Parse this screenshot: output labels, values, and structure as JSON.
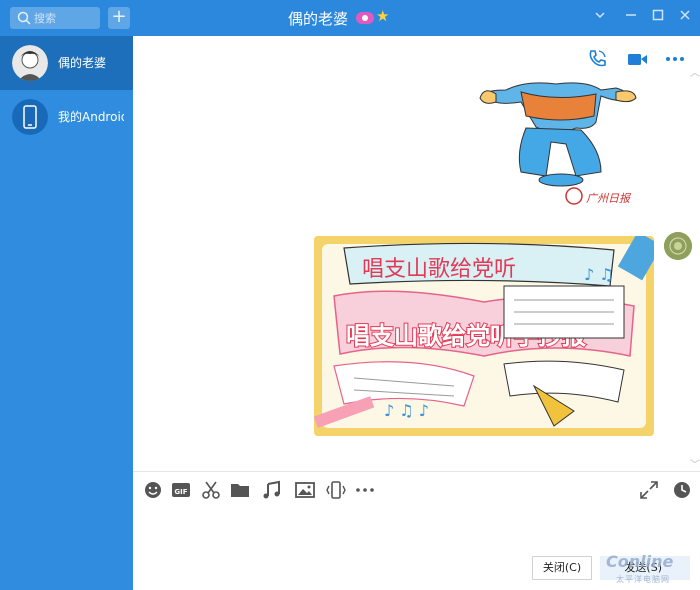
{
  "titlebar": {
    "search_placeholder": "搜索",
    "add_label": "+",
    "chat_title": "偶的老婆",
    "minimize_label": "—",
    "maximize_label": "☐",
    "close_label": "✕",
    "dropdown_label": "⌄"
  },
  "sidebar": {
    "contacts": [
      {
        "name": "偶的老婆",
        "active": true
      },
      {
        "name": "我的Android手机",
        "active": false
      }
    ]
  },
  "chat": {
    "poster_text_top": "唱支山歌给党听",
    "poster_text_main": "唱支山歌给党听手抄报",
    "sticker_caption": "广州日报"
  },
  "input_toolbar": {
    "icons": [
      "emoji-icon",
      "gif-icon",
      "scissors-icon",
      "folder-icon",
      "music-icon",
      "image-icon",
      "shake-icon",
      "more-icon"
    ]
  },
  "actions": {
    "close_button": "关闭(C)",
    "send_button": "发送(S)"
  },
  "watermark": {
    "brand": "Conline",
    "sub": "太平洋电脑网"
  },
  "colors": {
    "titlebar": "#2b88dc",
    "sidebar": "#2f8cde",
    "sidebar_active": "#1e6fbb",
    "accent": "#1f7fd6"
  }
}
